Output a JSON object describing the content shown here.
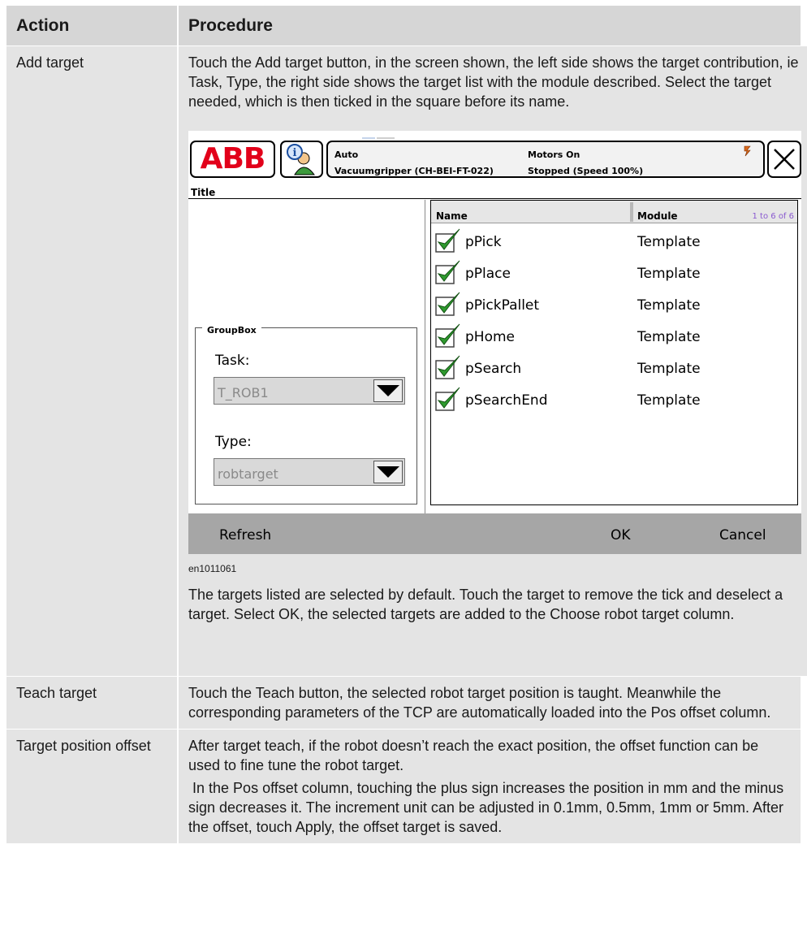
{
  "header": {
    "action": "Action",
    "procedure": "Procedure"
  },
  "rows": [
    {
      "action": "Add target",
      "para1": "Touch the Add target button, in the screen shown, the left side shows the target contribution, ie Task, Type, the right side shows the target list with the module described. Select the target needed, which is then ticked in the square before its name.",
      "figure_id": "en1011061",
      "para2": "The targets listed are selected by default. Touch the target to remove the tick and deselect a target. Select OK, the selected targets are added to the Choose robot target column."
    },
    {
      "action": "Teach target",
      "para1": "Touch the Teach button, the selected robot target position is taught. Meanwhile the corresponding parameters of the TCP are automatically loaded into the Pos offset column."
    },
    {
      "action": "Target position offset",
      "para1": "After target teach, if the robot doesn’t reach the exact position, the offset function can be used to fine tune the robot target.",
      "para2": " In the Pos offset column, touching the plus sign increases the position in mm and the minus sign decreases it. The increment unit can be adjusted in 0.1mm, 0.5mm, 1mm or 5mm. After the offset, touch Apply, the offset target is saved."
    }
  ],
  "screen": {
    "logo": "ABB",
    "status": {
      "mode": "Auto",
      "motors": "Motors On",
      "system": "Vacuumgripper (CH-BEI-FT-022)",
      "state": "Stopped (Speed 100%)"
    },
    "title": "Title",
    "groupbox": {
      "legend": "GroupBox",
      "task_label": "Task:",
      "task_value": "T_ROB1",
      "type_label": "Type:",
      "type_value": "robtarget"
    },
    "list": {
      "col_name": "Name",
      "col_module": "Module",
      "count": "1 to 6 of 6",
      "items": [
        {
          "name": "pPick",
          "module": "Template",
          "checked": true
        },
        {
          "name": "pPlace",
          "module": "Template",
          "checked": true
        },
        {
          "name": "pPickPallet",
          "module": "Template",
          "checked": true
        },
        {
          "name": "pHome",
          "module": "Template",
          "checked": true
        },
        {
          "name": "pSearch",
          "module": "Template",
          "checked": true
        },
        {
          "name": "pSearchEnd",
          "module": "Template",
          "checked": true
        }
      ]
    },
    "buttons": {
      "refresh": "Refresh",
      "ok": "OK",
      "cancel": "Cancel"
    }
  },
  "colors": {
    "cell_bg": "#e4e4e4",
    "header_bg": "#d6d6d6",
    "abb_red": "#e2001a",
    "check_green": "#2e9a2e"
  }
}
